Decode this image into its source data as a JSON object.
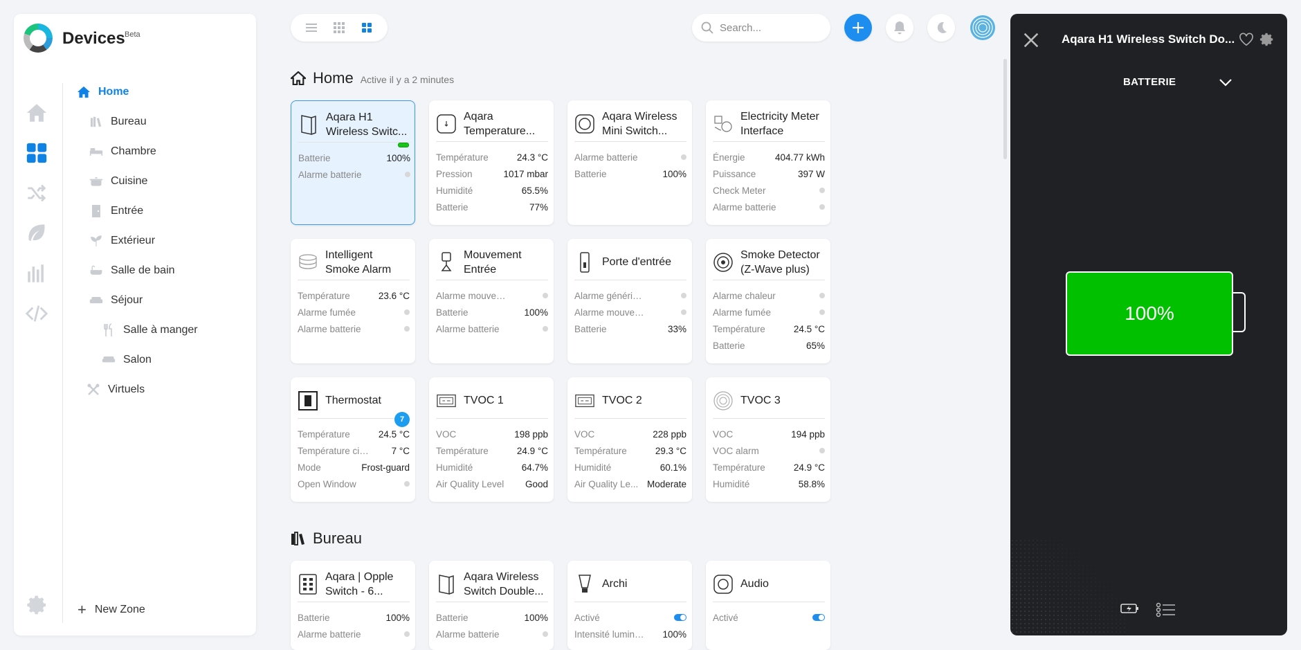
{
  "app": {
    "title": "Devices",
    "beta": "Beta"
  },
  "search": {
    "placeholder": "Search..."
  },
  "zones": {
    "home": "Home",
    "items": [
      {
        "label": "Bureau",
        "icon": "books-icon"
      },
      {
        "label": "Chambre",
        "icon": "bed-icon"
      },
      {
        "label": "Cuisine",
        "icon": "pot-icon"
      },
      {
        "label": "Entrée",
        "icon": "door-icon"
      },
      {
        "label": "Extérieur",
        "icon": "sprout-icon"
      },
      {
        "label": "Salle de bain",
        "icon": "bathtub-icon"
      },
      {
        "label": "Séjour",
        "icon": "sofa-icon"
      },
      {
        "label": "Salle à manger",
        "icon": "cutlery-icon"
      },
      {
        "label": "Salon",
        "icon": "couch-icon"
      },
      {
        "label": "Virtuels",
        "icon": "tools-icon"
      }
    ],
    "new_zone": "New Zone"
  },
  "home": {
    "title": "Home",
    "subtitle": "Active il y a 2 minutes"
  },
  "bureau": {
    "title": "Bureau"
  },
  "cards": [
    {
      "title": "Aqara H1 Wireless Switc...",
      "props": [
        {
          "l": "Batterie",
          "v": "100%"
        },
        {
          "l": "Alarme batterie",
          "v": ""
        }
      ]
    },
    {
      "title": "Aqara Temperature...",
      "props": [
        {
          "l": "Température",
          "v": "24.3 °C"
        },
        {
          "l": "Pression",
          "v": "1017 mbar"
        },
        {
          "l": "Humidité",
          "v": "65.5%"
        },
        {
          "l": "Batterie",
          "v": "77%"
        }
      ]
    },
    {
      "title": "Aqara Wireless Mini Switch...",
      "props": [
        {
          "l": "Alarme batterie",
          "v": ""
        },
        {
          "l": "Batterie",
          "v": "100%"
        }
      ]
    },
    {
      "title": "Electricity Meter Interface",
      "props": [
        {
          "l": "Énergie",
          "v": "404.77 kWh"
        },
        {
          "l": "Puissance",
          "v": "397 W"
        },
        {
          "l": "Check Meter",
          "v": ""
        },
        {
          "l": "Alarme batterie",
          "v": ""
        }
      ]
    },
    {
      "title": "Intelligent Smoke Alarm",
      "props": [
        {
          "l": "Température",
          "v": "23.6 °C"
        },
        {
          "l": "Alarme fumée",
          "v": ""
        },
        {
          "l": "Alarme batterie",
          "v": ""
        }
      ]
    },
    {
      "title": "Mouvement Entrée",
      "props": [
        {
          "l": "Alarme mouvement",
          "v": ""
        },
        {
          "l": "Batterie",
          "v": "100%"
        },
        {
          "l": "Alarme batterie",
          "v": ""
        }
      ]
    },
    {
      "title": "Porte d'entrée",
      "props": [
        {
          "l": "Alarme générique",
          "v": ""
        },
        {
          "l": "Alarme mouvement",
          "v": ""
        },
        {
          "l": "Batterie",
          "v": "33%"
        }
      ]
    },
    {
      "title": "Smoke Detector (Z-Wave plus)",
      "props": [
        {
          "l": "Alarme chaleur",
          "v": ""
        },
        {
          "l": "Alarme fumée",
          "v": ""
        },
        {
          "l": "Température",
          "v": "24.5 °C"
        },
        {
          "l": "Batterie",
          "v": "65%"
        }
      ]
    },
    {
      "title": "Thermostat",
      "badge": "7",
      "props": [
        {
          "l": "Température",
          "v": "24.5 °C"
        },
        {
          "l": "Température cible",
          "v": "7 °C"
        },
        {
          "l": "Mode",
          "v": "Frost-guard"
        },
        {
          "l": "Open Window",
          "v": ""
        }
      ]
    },
    {
      "title": "TVOC 1",
      "props": [
        {
          "l": "VOC",
          "v": "198 ppb"
        },
        {
          "l": "Température",
          "v": "24.9 °C"
        },
        {
          "l": "Humidité",
          "v": "64.7%"
        },
        {
          "l": "Air Quality Level",
          "v": "Good"
        }
      ]
    },
    {
      "title": "TVOC 2",
      "props": [
        {
          "l": "VOC",
          "v": "228 ppb"
        },
        {
          "l": "Température",
          "v": "29.3 °C"
        },
        {
          "l": "Humidité",
          "v": "60.1%"
        },
        {
          "l": "Air Quality Le...",
          "v": "Moderate"
        }
      ]
    },
    {
      "title": "TVOC 3",
      "props": [
        {
          "l": "VOC",
          "v": "194 ppb"
        },
        {
          "l": "VOC alarm",
          "v": ""
        },
        {
          "l": "Température",
          "v": "24.9 °C"
        },
        {
          "l": "Humidité",
          "v": "58.8%"
        }
      ]
    },
    {
      "title": "Aqara | Opple Switch - 6...",
      "props": [
        {
          "l": "Batterie",
          "v": "100%"
        },
        {
          "l": "Alarme batterie",
          "v": ""
        }
      ]
    },
    {
      "title": "Aqara Wireless Switch Double...",
      "props": [
        {
          "l": "Batterie",
          "v": "100%"
        },
        {
          "l": "Alarme batterie",
          "v": ""
        }
      ]
    },
    {
      "title": "Archi",
      "props": [
        {
          "l": "Activé",
          "v": ""
        },
        {
          "l": "Intensité lumineu...",
          "v": "100%"
        }
      ]
    },
    {
      "title": "Audio",
      "props": [
        {
          "l": "Activé",
          "v": ""
        }
      ]
    }
  ],
  "panel": {
    "title": "Aqara H1 Wireless Switch Do...",
    "capability": "BATTERIE",
    "battery_value": "100%",
    "battery_level": 1.0,
    "battery_color": "#00c000"
  },
  "colors": {
    "accent": "#0f82e6",
    "add_button": "#1d8ef0",
    "panel_bg": "#202124"
  }
}
